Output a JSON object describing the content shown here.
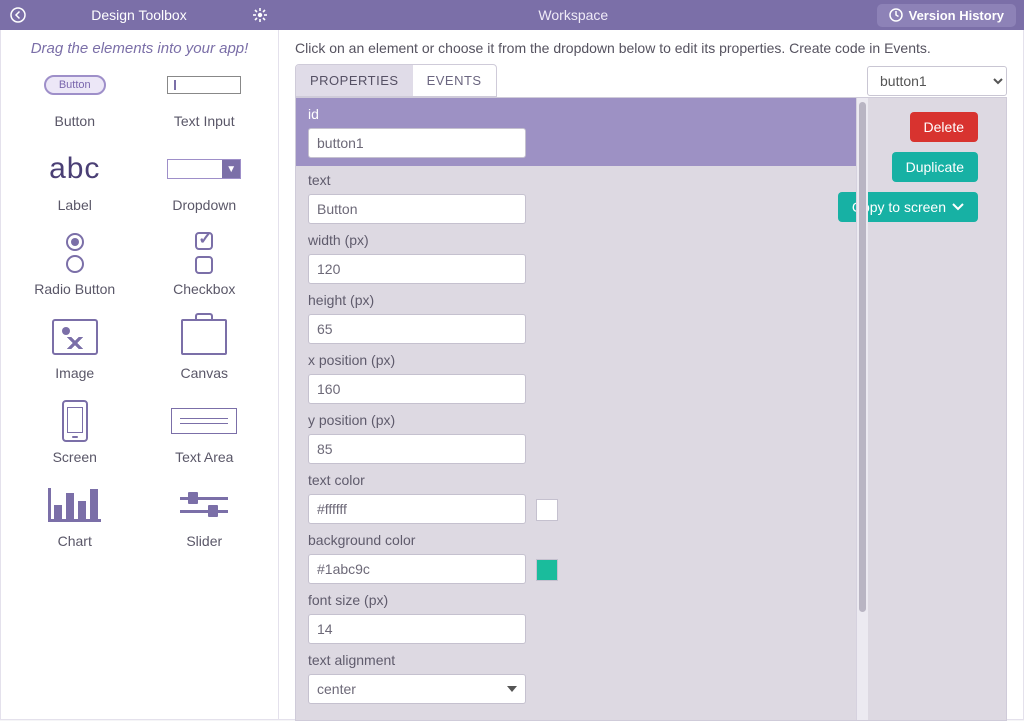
{
  "titlebar": {
    "toolbox_title": "Design Toolbox",
    "workspace_title": "Workspace",
    "version_history": "Version History"
  },
  "toolbox": {
    "hint": "Drag the elements into your app!",
    "items": [
      {
        "label": "Button",
        "icon": "button-icon"
      },
      {
        "label": "Text Input",
        "icon": "text-input-icon"
      },
      {
        "label": "Label",
        "icon": "label-icon"
      },
      {
        "label": "Dropdown",
        "icon": "dropdown-icon"
      },
      {
        "label": "Radio Button",
        "icon": "radio-icon"
      },
      {
        "label": "Checkbox",
        "icon": "checkbox-icon"
      },
      {
        "label": "Image",
        "icon": "image-icon"
      },
      {
        "label": "Canvas",
        "icon": "canvas-icon"
      },
      {
        "label": "Screen",
        "icon": "screen-icon"
      },
      {
        "label": "Text Area",
        "icon": "textarea-icon"
      },
      {
        "label": "Chart",
        "icon": "chart-icon"
      },
      {
        "label": "Slider",
        "icon": "slider-icon"
      }
    ]
  },
  "workspace": {
    "instruction": "Click on an element or choose it from the dropdown below to edit its properties. Create code in Events.",
    "tabs": {
      "properties": "PROPERTIES",
      "events": "EVENTS",
      "active": "properties"
    },
    "element_selector": {
      "selected": "button1"
    },
    "actions": {
      "delete": "Delete",
      "duplicate": "Duplicate",
      "copy_to_screen": "Copy to screen"
    },
    "properties": {
      "id": {
        "label": "id",
        "value": "button1"
      },
      "text": {
        "label": "text",
        "value": "Button"
      },
      "width": {
        "label": "width (px)",
        "value": "120"
      },
      "height": {
        "label": "height (px)",
        "value": "65"
      },
      "x": {
        "label": "x position (px)",
        "value": "160"
      },
      "y": {
        "label": "y position (px)",
        "value": "85"
      },
      "text_color": {
        "label": "text color",
        "value": "#ffffff",
        "swatch": "#ffffff"
      },
      "background_color": {
        "label": "background color",
        "value": "#1abc9c",
        "swatch": "#1abc9c"
      },
      "font_size": {
        "label": "font size (px)",
        "value": "14"
      },
      "text_alignment": {
        "label": "text alignment",
        "value": "center"
      }
    }
  },
  "colors": {
    "brand": "#7b6fa8",
    "teal": "#17b1a4",
    "danger": "#d8332f"
  }
}
